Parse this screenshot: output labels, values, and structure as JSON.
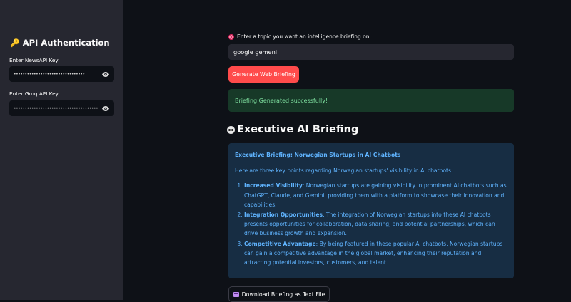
{
  "sidebar": {
    "title": "API Authentication",
    "newsapi_label": "Enter NewsAPI Key:",
    "newsapi_value": "••••••••••••••••••••••••••••••••",
    "groq_label": "Enter Groq API Key:",
    "groq_value": "••••••••••••••••••••••••••••••••••••••••••••••••••••••"
  },
  "main": {
    "topic_label": "Enter a topic you want an intelligence briefing on:",
    "topic_value": "google gemeni",
    "generate_label": "Generate Web Briefing",
    "success_message": "Briefing Generated successfully!",
    "section_heading": "Executive AI Briefing",
    "briefing": {
      "title": "Executive Briefing: Norwegian Startups in AI Chatbots",
      "intro": "Here are three key points regarding Norwegian startups' visibility in AI chatbots:",
      "points": [
        {
          "head": "Increased Visibility",
          "text": ": Norwegian startups are gaining visibility in prominent AI chatbots such as ChatGPT, Claude, and Gemini, providing them with a platform to showcase their innovation and capabilities."
        },
        {
          "head": "Integration Opportunities",
          "text": ": The integration of Norwegian startups into these AI chatbots presents opportunities for collaboration, data sharing, and potential partnerships, which can drive business growth and expansion."
        },
        {
          "head": "Competitive Advantage",
          "text": ": By being featured in these popular AI chatbots, Norwegian startups can gain a competitive advantage in the global market, enhancing their reputation and attracting potential investors, customers, and talent."
        }
      ]
    },
    "download_label": "Download Briefing as Text File"
  },
  "colors": {
    "app_bg": "#0e1117",
    "sidebar_bg": "#262730",
    "primary_button": "#ff4b4b",
    "success_bg": "#173928",
    "info_bg": "#172d43",
    "info_text": "#60b4ff"
  },
  "icons": {
    "sidebar_title": "key-icon",
    "topic_label": "target-icon",
    "section_heading": "robot-face-icon",
    "password_toggle": "eye-icon",
    "download": "package-icon"
  }
}
